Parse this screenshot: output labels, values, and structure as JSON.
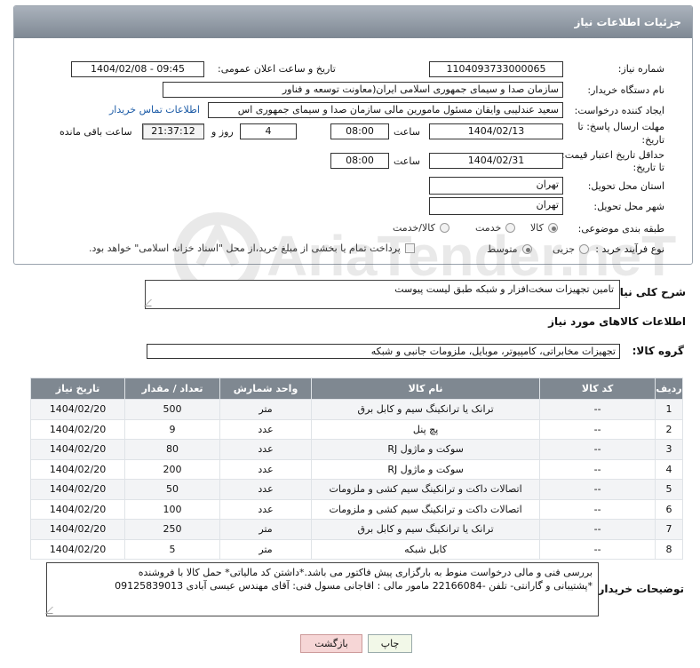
{
  "header": {
    "title": "جزئیات اطلاعات نیاز"
  },
  "watermark": "AriaTender.neT",
  "fields": {
    "need_number_label": "شماره نیاز:",
    "need_number": "1104093733000065",
    "announce_label": "تاریخ و ساعت اعلان عمومی:",
    "announce_value": "1404/02/08 - 09:45",
    "buyer_org_label": "نام دستگاه خریدار:",
    "buyer_org": "سازمان صدا و سیمای جمهوری اسلامی ایران(معاونت توسعه و فناور",
    "creator_label": "ایجاد کننده درخواست:",
    "creator": "سعید عندلیبی وایقان مسئول مامورین مالی  سازمان صدا و سیمای جمهوری اس",
    "contact_link": "اطلاعات تماس خریدار",
    "deadline_label_1": "مهلت ارسال پاسخ: تا",
    "deadline_label_2": "تاریخ:",
    "deadline_date": "1404/02/13",
    "time_label": "ساعت",
    "deadline_time": "08:00",
    "days_value": "4",
    "days_label": "روز و",
    "remaining_time": "21:37:12",
    "remaining_label": "ساعت باقی مانده",
    "validity_label_1": "حداقل تاریخ اعتبار قیمت:",
    "validity_label_2": "تا تاریخ:",
    "validity_date": "1404/02/31",
    "validity_time": "08:00",
    "province_label": "استان محل تحویل:",
    "province": "تهران",
    "city_label": "شهر محل تحویل:",
    "city": "تهران",
    "category_label": "طبقه بندی موضوعی:",
    "category_options": [
      "کالا",
      "خدمت",
      "کالا/خدمت"
    ],
    "category_selected": "کالا",
    "process_label": "نوع فرآیند خرید :",
    "process_options": [
      "جزیی",
      "متوسط"
    ],
    "process_selected": "متوسط",
    "payment_note": "پرداخت تمام یا بخشی از مبلغ خرید،از محل \"اسناد خزانه اسلامی\" خواهد بود."
  },
  "description": {
    "label": "شرح کلی نیاز:",
    "text": "تامین تجهیزات سخت‌افزار و شبکه طبق لیست پیوست"
  },
  "goods": {
    "section_title": "اطلاعات کالاهای مورد نیاز",
    "group_label": "گروه کالا:",
    "group_value": "تجهیزات مخابراتی، کامپیوتر، موبایل، ملزومات جانبی و شبکه",
    "columns": [
      "ردیف",
      "کد کالا",
      "نام کالا",
      "واحد شمارش",
      "تعداد / مقدار",
      "تاریخ نیاز"
    ],
    "rows": [
      [
        "1",
        "--",
        "ترانک یا ترانکینگ سیم و کابل برق",
        "متر",
        "500",
        "1404/02/20"
      ],
      [
        "2",
        "--",
        "پچ پنل",
        "عدد",
        "9",
        "1404/02/20"
      ],
      [
        "3",
        "--",
        "سوکت و ماژول RJ",
        "عدد",
        "80",
        "1404/02/20"
      ],
      [
        "4",
        "--",
        "سوکت و ماژول RJ",
        "عدد",
        "200",
        "1404/02/20"
      ],
      [
        "5",
        "--",
        "اتصالات داکت و ترانکینگ سیم کشی و ملزومات",
        "عدد",
        "50",
        "1404/02/20"
      ],
      [
        "6",
        "--",
        "اتصالات داکت و ترانکینگ سیم کشی و ملزومات",
        "عدد",
        "100",
        "1404/02/20"
      ],
      [
        "7",
        "--",
        "ترانک یا ترانکینگ سیم و کابل برق",
        "متر",
        "250",
        "1404/02/20"
      ],
      [
        "8",
        "--",
        "کابل شبکه",
        "متر",
        "5",
        "1404/02/20"
      ]
    ]
  },
  "buyer_notes": {
    "label": "توضیحات خریدار:",
    "line1": "بررسی فنی و مالی درخواست منوط به بارگزاری پیش فاکتور می باشد.*داشتن کد مالیاتی*  حمل کالا با فروشنده",
    "line2": "*پشتیبانی و گارانتی- تلفن -22166084 مامور مالی : اقاجانی مسول فنی: آقای مهندس عیسی آبادی 09125839013"
  },
  "buttons": {
    "print": "چاپ",
    "back": "بازگشت"
  },
  "colors": {
    "header_bg": "#8a939d",
    "table_header_bg": "#7f8891",
    "link": "#1a5aa6",
    "back_button_bg": "#f6d6d6"
  }
}
